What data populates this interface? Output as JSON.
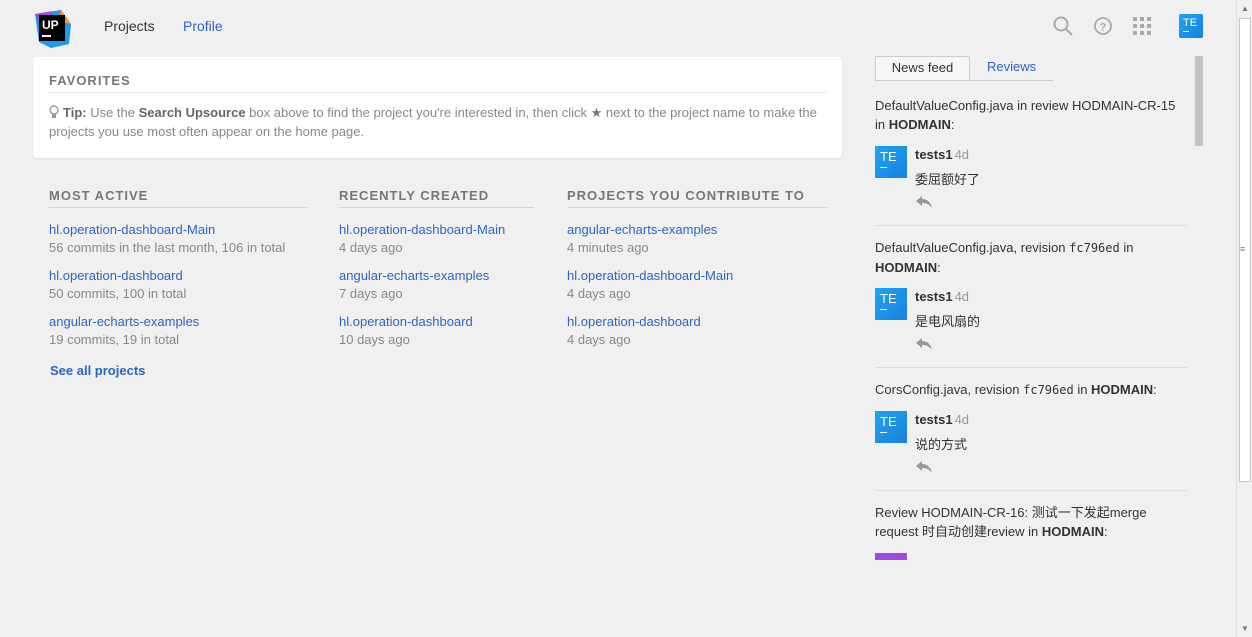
{
  "header": {
    "logo_text": "UP",
    "nav": {
      "projects": "Projects",
      "profile": "Profile"
    },
    "icons": [
      "search-icon",
      "help-icon",
      "apps-grid-icon"
    ],
    "user_avatar": "TE",
    "accent": "#2b66c4"
  },
  "favorites": {
    "title": "FAVORITES",
    "tip_label": "Tip:",
    "tip_text_1": " Use the ",
    "tip_bold": "Search Upsource",
    "tip_text_2": " box above to find the project you're interested in, then click ",
    "tip_text_3": " next to the project name to make the projects you use most often appear on the home page."
  },
  "columns": [
    {
      "title": "MOST ACTIVE",
      "items": [
        {
          "name": "hl.operation-dashboard-Main",
          "meta": "56 commits in the last month, 106 in total"
        },
        {
          "name": "hl.operation-dashboard",
          "meta": "50 commits, 100 in total"
        },
        {
          "name": "angular-echarts-examples",
          "meta": "19 commits, 19 in total"
        }
      ]
    },
    {
      "title": "RECENTLY CREATED",
      "items": [
        {
          "name": "hl.operation-dashboard-Main",
          "meta": "4 days ago"
        },
        {
          "name": "angular-echarts-examples",
          "meta": "7 days ago"
        },
        {
          "name": "hl.operation-dashboard",
          "meta": "10 days ago"
        }
      ]
    },
    {
      "title": "PROJECTS YOU CONTRIBUTE TO",
      "items": [
        {
          "name": "angular-echarts-examples",
          "meta": "4 minutes ago"
        },
        {
          "name": "hl.operation-dashboard-Main",
          "meta": "4 days ago"
        },
        {
          "name": "hl.operation-dashboard",
          "meta": "4 days ago"
        }
      ]
    }
  ],
  "see_all": "See all projects",
  "feed": {
    "tabs": {
      "news": "News feed",
      "reviews": "Reviews"
    },
    "items": [
      {
        "file": "DefaultValueConfig.java in review HODMAIN-CR-15 in ",
        "project": "HODMAIN",
        "suffix": ":",
        "avatar": "TE",
        "author": "tests1",
        "age": "4d",
        "comment": "委屈额好了"
      },
      {
        "file": "DefaultValueConfig.java, revision ",
        "revision": "fc796ed",
        "mid": " in ",
        "project": "HODMAIN",
        "suffix": ":",
        "avatar": "TE",
        "author": "tests1",
        "age": "4d",
        "comment": "是电风扇的"
      },
      {
        "file": "CorsConfig.java, revision ",
        "revision": "fc796ed",
        "mid": " in ",
        "project": "HODMAIN",
        "suffix": ":",
        "avatar": "TE",
        "author": "tests1",
        "age": "4d",
        "comment": "说的方式"
      },
      {
        "file": "Review HODMAIN-CR-16: 测试一下发起merge request 时自动创建review in ",
        "project": "HODMAIN",
        "suffix": ":"
      }
    ]
  }
}
